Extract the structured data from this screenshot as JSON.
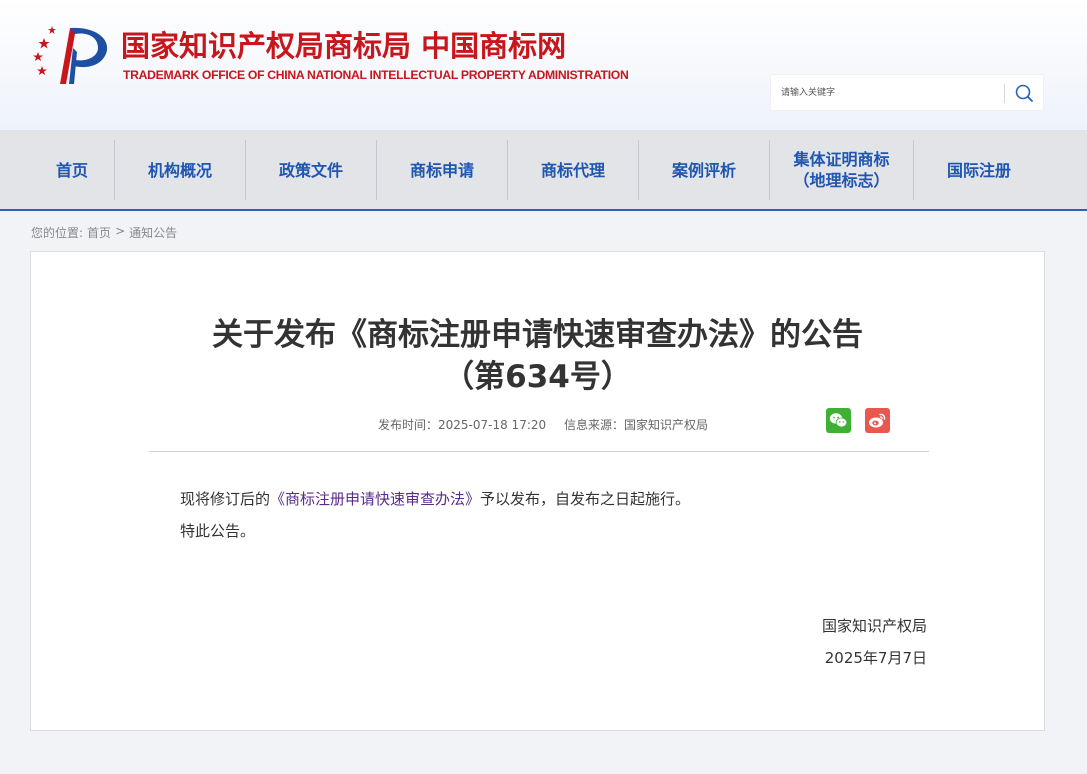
{
  "header": {
    "logo_cn": "国家知识产权局商标局 中国商标网",
    "logo_en": "TRADEMARK OFFICE OF CHINA NATIONAL INTELLECTUAL PROPERTY ADMINISTRATION",
    "search_placeholder": "请输入关键字"
  },
  "nav": {
    "items": [
      {
        "label": "首页"
      },
      {
        "label": "机构概况"
      },
      {
        "label": "政策文件"
      },
      {
        "label": "商标申请"
      },
      {
        "label": "商标代理"
      },
      {
        "label": "案例评析"
      },
      {
        "label": "集体证明商标",
        "label2": "（地理标志）"
      },
      {
        "label": "国际注册"
      }
    ]
  },
  "breadcrumb": {
    "prefix": "您的位置:",
    "home": "首页",
    "sep": ">",
    "current": "通知公告"
  },
  "article": {
    "title_line1": "关于发布《商标注册申请快速审查办法》的公告",
    "title_line2": "（第634号）",
    "publish_time": "发布时间：2025-07-18 17:20",
    "source": "信息来源：国家知识产权局",
    "para1_before": "现将修订后的",
    "para1_link": "《商标注册申请快速审查办法》",
    "para1_after": "予以发布，自发布之日起施行。",
    "para2": "特此公告。",
    "signature_org": "国家知识产权局",
    "signature_date": "2025年7月7日"
  },
  "colors": {
    "brand_red": "#c8161d",
    "nav_blue": "#1e56b0",
    "wechat_green": "#3eb135",
    "weibo_red": "#e8584f"
  }
}
